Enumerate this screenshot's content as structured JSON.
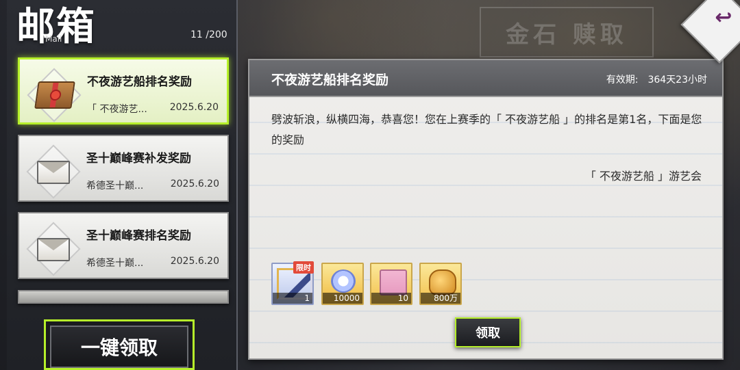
{
  "header": {
    "title": "邮箱",
    "subtitle": "Mail",
    "count": "11 /200"
  },
  "mails": [
    {
      "title": "不夜游艺船排名奖励",
      "sender": "「 不夜游艺...",
      "date": "2025.6.20",
      "icon": "gift-box-icon",
      "selected": true
    },
    {
      "title": "圣十巅峰赛补发奖励",
      "sender": "希德圣十巅...",
      "date": "2025.6.20",
      "icon": "envelope-icon",
      "selected": false
    },
    {
      "title": "圣十巅峰赛排名奖励",
      "sender": "希德圣十巅...",
      "date": "2025.6.20",
      "icon": "envelope-icon",
      "selected": false
    }
  ],
  "claim_all_label": "一键领取",
  "detail": {
    "title": "不夜游艺船排名奖励",
    "validity_label": "有效期:",
    "validity_value": "364天23小时",
    "body": "劈波斩浪，纵横四海，恭喜您！您在上赛季的「 不夜游艺船 」的排名是第1名，下面是您的奖励",
    "signature": "「 不夜游艺船 」游艺会",
    "rewards": [
      {
        "name": "frame-item-icon",
        "qty": "1",
        "tag": "限时"
      },
      {
        "name": "medal-item-icon",
        "qty": "10000"
      },
      {
        "name": "chest-item-icon",
        "qty": "10"
      },
      {
        "name": "gold-item-icon",
        "qty": "800万"
      }
    ],
    "claim_label": "领取"
  },
  "back_icon": "back-arrow-icon",
  "bg_sign": "金石 赎取",
  "accent_color": "#b6f02a"
}
